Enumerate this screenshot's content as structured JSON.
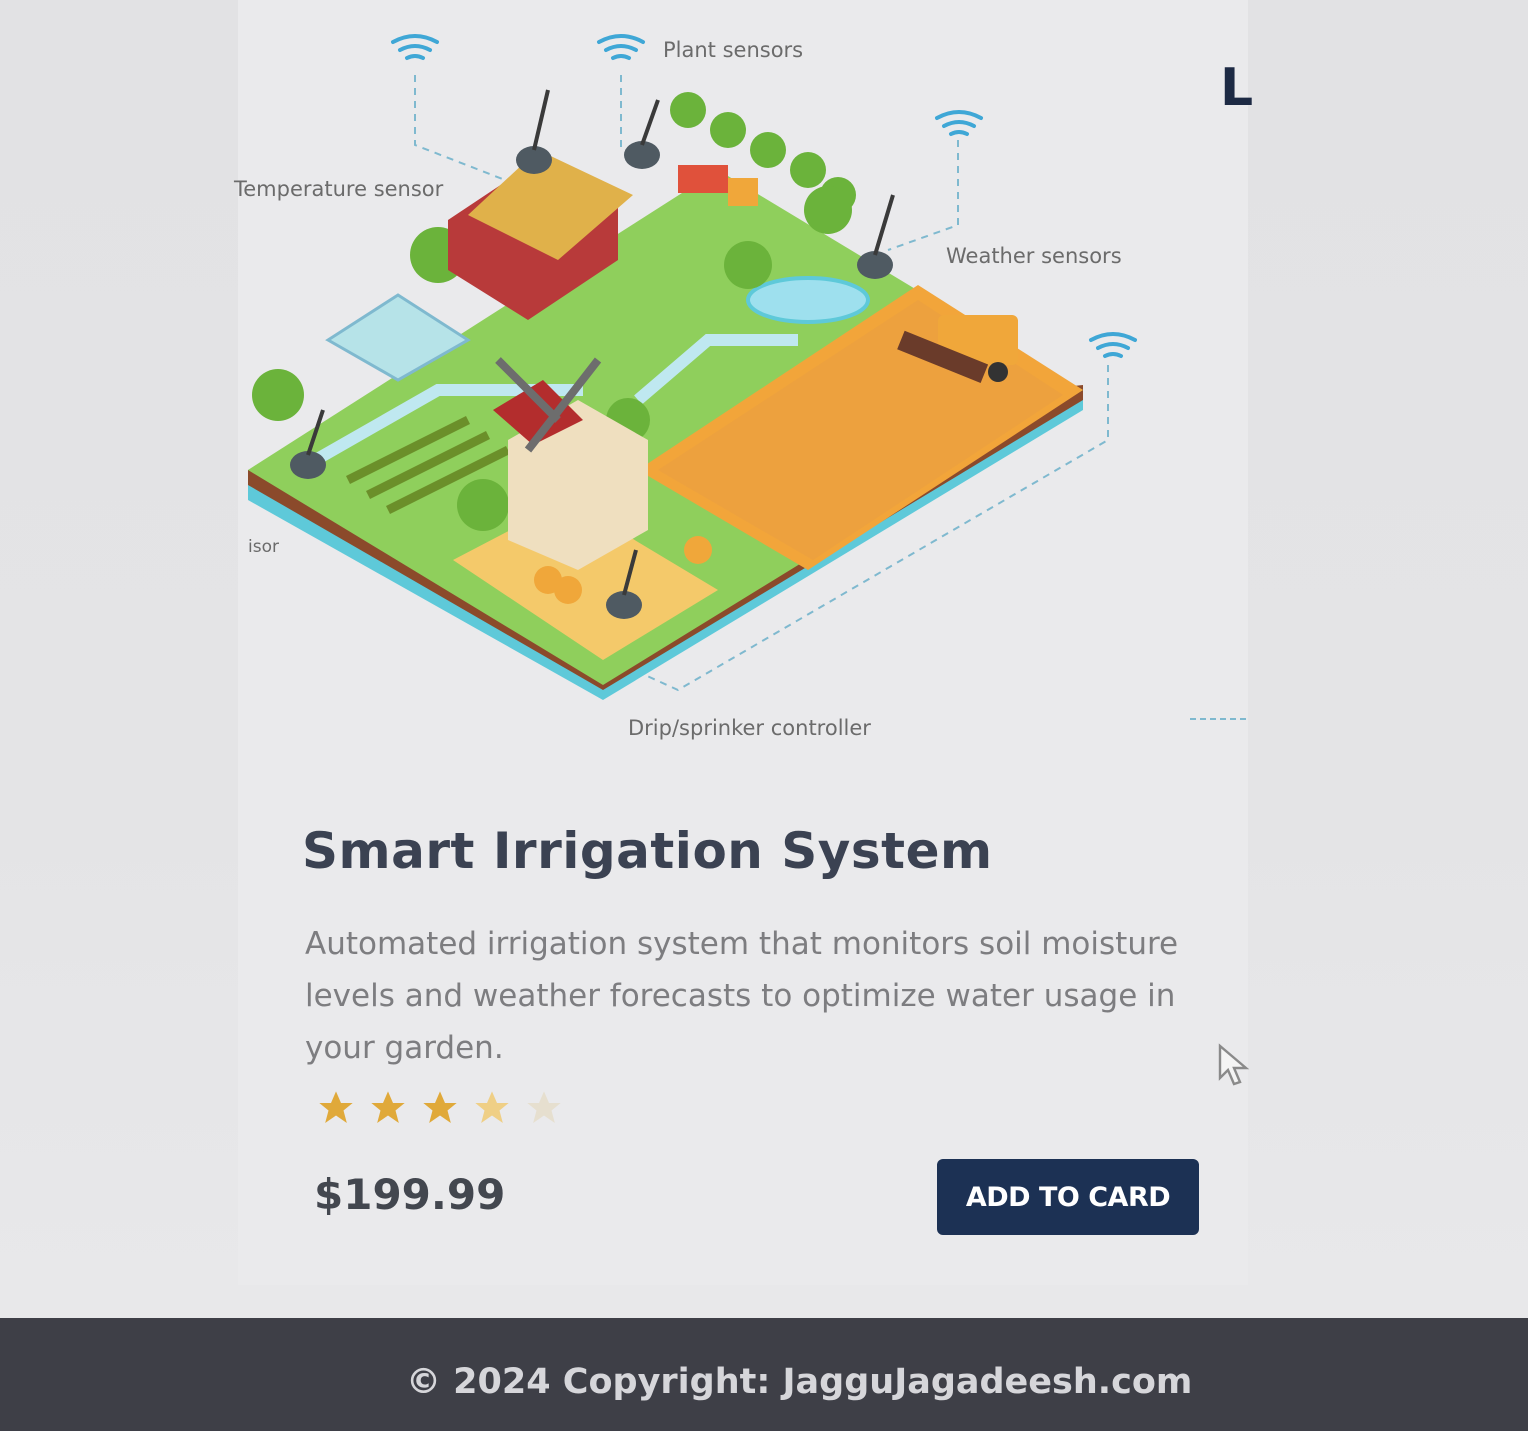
{
  "illustration": {
    "labels": {
      "plant_sensors": "Plant sensors",
      "temperature_sensor": "Temperature sensor",
      "weather_sensors": "Weather sensors",
      "soil_sensor": "isor",
      "drip_controller": "Drip/sprinker controller"
    }
  },
  "next_card": {
    "logo_text": "L"
  },
  "product": {
    "title": "Smart Irrigation System",
    "description": "Automated irrigation system that monitors soil moisture levels and weather forecasts to optimize water usage in your garden.",
    "rating": 3.5,
    "rating_max": 5,
    "price": "$199.99",
    "add_button_label": "ADD TO CARD"
  },
  "footer": {
    "copyright": "© 2024 Copyright: JagguJagadeesh.com"
  },
  "colors": {
    "button_bg": "#1c3154",
    "star_filled": "#e0a93a",
    "title": "#3b4252",
    "footer_bg": "#3e3f47"
  }
}
